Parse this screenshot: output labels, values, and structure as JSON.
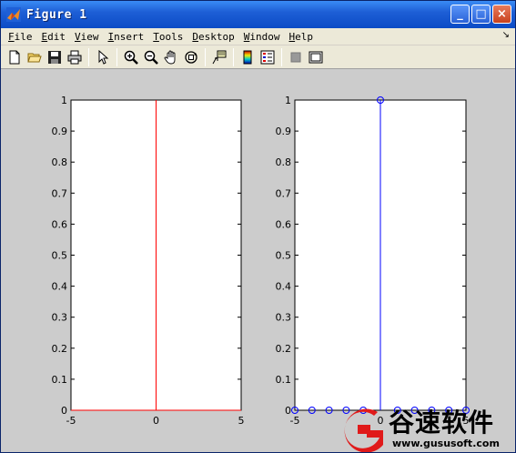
{
  "window": {
    "title": "Figure 1",
    "minimize_glyph": "_",
    "maximize_glyph": "□",
    "close_glyph": "×"
  },
  "menu": {
    "items": [
      {
        "first": "F",
        "rest": "ile"
      },
      {
        "first": "E",
        "rest": "dit"
      },
      {
        "first": "V",
        "rest": "iew"
      },
      {
        "first": "I",
        "rest": "nsert"
      },
      {
        "first": "T",
        "rest": "ools"
      },
      {
        "first": "D",
        "rest": "esktop"
      },
      {
        "first": "W",
        "rest": "indow"
      },
      {
        "first": "H",
        "rest": "elp"
      }
    ],
    "overflow_glyph": "↘"
  },
  "toolbar": {
    "icons": [
      "new-file-icon",
      "open-folder-icon",
      "save-icon",
      "print-icon",
      "|",
      "pointer-arrow-icon",
      "|",
      "zoom-in-icon",
      "zoom-out-icon",
      "pan-hand-icon",
      "rotate-3d-icon",
      "|",
      "data-cursor-icon",
      "|",
      "colorbar-icon",
      "legend-icon",
      "|",
      "hide-plot-tools-icon",
      "show-plot-tools-icon"
    ]
  },
  "chart_data": [
    {
      "type": "line",
      "xlim": [
        -5,
        5
      ],
      "ylim": [
        0,
        1
      ],
      "x_ticks": [
        "-5",
        "0",
        "5"
      ],
      "y_ticks": [
        "0",
        "0.1",
        "0.2",
        "0.3",
        "0.4",
        "0.5",
        "0.6",
        "0.7",
        "0.8",
        "0.9",
        "1"
      ],
      "series": [
        {
          "color": "#ff0000",
          "x": [
            -5,
            0,
            0,
            0,
            5
          ],
          "y": [
            0,
            0,
            1,
            0,
            0
          ]
        }
      ]
    },
    {
      "type": "stem",
      "xlim": [
        -5,
        5
      ],
      "ylim": [
        0,
        1
      ],
      "x_ticks": [
        "-5",
        "0",
        "5"
      ],
      "y_ticks": [
        "0",
        "0.1",
        "0.2",
        "0.3",
        "0.4",
        "0.5",
        "0.6",
        "0.7",
        "0.8",
        "0.9",
        "1"
      ],
      "series": [
        {
          "color": "#0000ff",
          "marker": "circle",
          "x": [
            -5,
            -4,
            -3,
            -2,
            -1,
            0,
            1,
            2,
            3,
            4,
            5
          ],
          "y": [
            0,
            0,
            0,
            0,
            0,
            1,
            0,
            0,
            0,
            0,
            0
          ]
        }
      ]
    }
  ],
  "watermark": {
    "chinese": "谷速软件",
    "url": "www.gususoft.com"
  }
}
